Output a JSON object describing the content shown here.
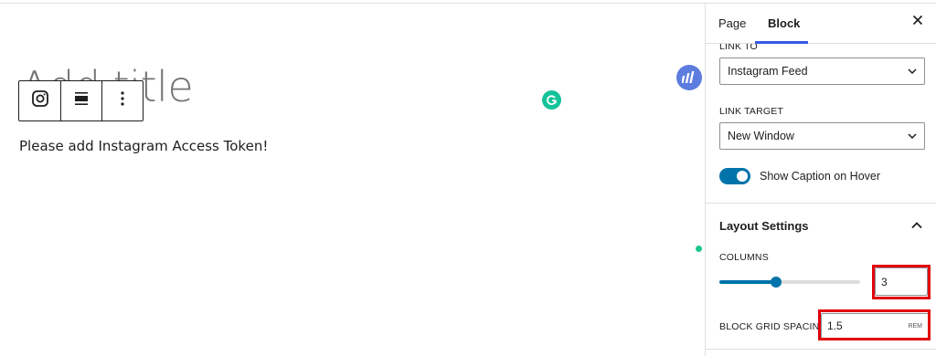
{
  "editor": {
    "title_placeholder": "Add title",
    "notice": "Please add Instagram Access Token!"
  },
  "toolbar": {
    "items": [
      {
        "icon": "instagram-icon"
      },
      {
        "icon": "align-icon"
      },
      {
        "icon": "more-options-icon"
      }
    ]
  },
  "sidebar": {
    "tabs": [
      {
        "label": "Page"
      },
      {
        "label": "Block"
      }
    ],
    "active_tab": "Block",
    "close_icon": "close-icon",
    "link_to": {
      "label": "LINK TO",
      "value": "Instagram Feed"
    },
    "link_target": {
      "label": "LINK TARGET",
      "value": "New Window"
    },
    "caption_toggle": {
      "label": "Show Caption on Hover",
      "checked": true
    },
    "layout_panel": {
      "title": "Layout Settings",
      "expanded": true,
      "columns": {
        "label": "COLUMNS",
        "value": "3",
        "slider_fraction": 0.4
      },
      "grid_spacing": {
        "label": "BLOCK GRID SPACING",
        "value": "1.5",
        "unit": "REM"
      }
    }
  },
  "colors": {
    "accent": "#0073aa",
    "tab_indicator": "#3858e9",
    "highlight": "#e3000b",
    "grammarly": "#15c39a"
  }
}
